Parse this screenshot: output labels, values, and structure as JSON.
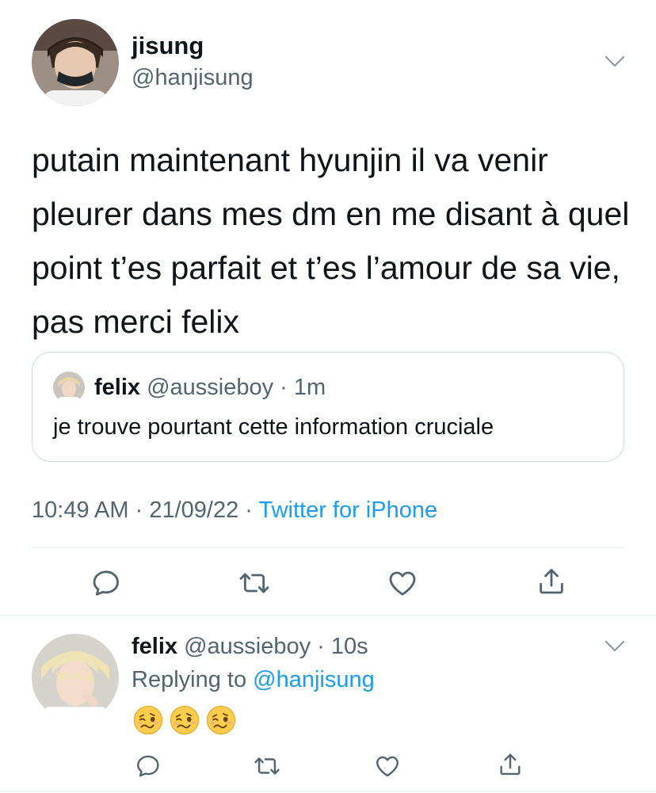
{
  "tweet": {
    "author_name": "jisung",
    "author_handle": "@hanjisung",
    "text": "putain maintenant hyunjin il va venir pleurer dans mes dm en me disant à quel point t’es parfait et t’es l’amour de sa vie, pas merci felix",
    "quote": {
      "author_name": "felix",
      "author_handle": "@aussieboy",
      "separator": " · ",
      "time": "1m",
      "text": "je trouve pourtant cette information cruciale"
    },
    "time": "10:49 AM",
    "date": "21/09/22",
    "separator": " · ",
    "source": "Twitter for iPhone"
  },
  "reply": {
    "author_name": "felix",
    "author_handle": "@aussieboy",
    "separator": " · ",
    "time": "10s",
    "replying_prefix": "Replying to ",
    "replying_to": "@hanjisung",
    "emoji_name": "woozy-face",
    "emoji_count": 3
  },
  "icons": {
    "more": "chevron-down-icon",
    "reply": "reply-icon",
    "retweet": "retweet-icon",
    "like": "like-icon",
    "share": "share-icon"
  },
  "colors": {
    "text": "#0f1419",
    "secondary": "#536471",
    "accent": "#1d9bf0",
    "border": "#cfd9de",
    "divider": "#eff3f4"
  }
}
